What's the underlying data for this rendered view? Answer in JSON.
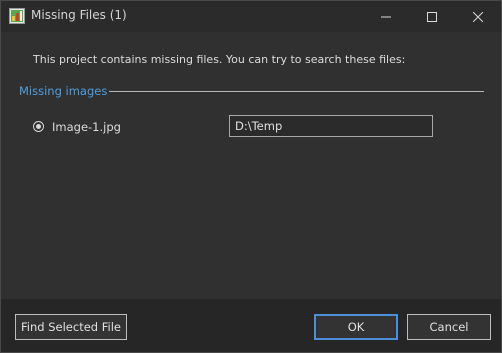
{
  "window": {
    "title": "Missing Files (1)"
  },
  "message": "This project contains missing files. You can try to search these files:",
  "missing_images": {
    "group_label": "Missing images",
    "items": [
      {
        "file_name": "Image-1.jpg",
        "path": "D:\\Temp",
        "selected": true
      }
    ]
  },
  "buttons": {
    "find_selected": "Find Selected File",
    "ok": "OK",
    "cancel": "Cancel"
  },
  "colors": {
    "group_label": "#4f9fdf",
    "default_button_border": "#4a8fd8"
  },
  "icons": {
    "app": "app-icon",
    "minimize": "minimize-icon",
    "maximize": "maximize-icon",
    "close": "close-icon"
  }
}
